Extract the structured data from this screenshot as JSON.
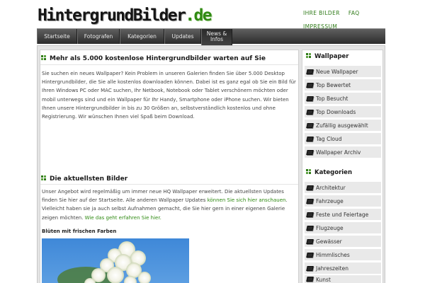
{
  "logo": {
    "part1": "HintergrundBilder",
    "part2": ".de"
  },
  "top_links": [
    "IHRE BILDER",
    "FAQ",
    "IMPRESSUM"
  ],
  "nav": [
    "Startseite",
    "Fotografen",
    "Kategorien",
    "Updates",
    "News &\nInfos"
  ],
  "intro": {
    "heading": "Mehr als 5.000 kostenlose Hintergrundbilder warten auf Sie",
    "text": "Sie suchen ein neues Wallpaper? Kein Problem in unseren Galerien finden Sie über 5.000 Desktop Hintergrundbilder, die Sie alle kostenlos downloaden können. Dabei ist es ganz egal ob Sie ein Bild für Ihren Windows PC oder MAC suchen, Ihr Netbook, Notebook oder Tablet verschönern möchten oder mobil unterwegs sind und ein Wallpaper für Ihr Handy, Smartphone oder iPhone suchen. Wir bieten Ihnen unsere Hintergrundbilder in bis zu 30 Größen an, selbstverständlich kostenlos und ohne Registrierung. Wir wünschen Ihnen viel Spaß beim Download."
  },
  "latest": {
    "heading": "Die aktuellsten Bilder",
    "text_1": "Unser Angebot wird regelmäßig um immer neue HQ Wallpaper erweitert. Die aktuellsten Updates finden Sie hier auf der Startseite. Alle anderen Wallpaper Updates ",
    "link_1": "können Sie sich hier anschauen",
    "text_2": ". Vielleicht haben sie ja auch selbst Aufnahmen gemacht, die Sie hier gern in einer eigenen Galerie zeigen möchten. ",
    "link_2": "Wie das geht erfahren Sie hier.",
    "subheading": "Blüten mit frischen Farben"
  },
  "sidebar": {
    "wallpaper_title": "Wallpaper",
    "wallpaper_items": [
      "Neue Wallpaper",
      "Top Bewertet",
      "Top Besucht",
      "Top Downloads",
      "Zufällig ausgewählt",
      "Tag Cloud",
      "Wallpaper Archiv"
    ],
    "kategorien_title": "Kategorien",
    "kategorien_items": [
      "Architektur",
      "Fahrzeuge",
      "Feste und Feiertage",
      "Flugzeuge",
      "Gewässer",
      "Himmlisches",
      "Jahreszeiten",
      "Kunst"
    ]
  },
  "colors": {
    "accent": "#2f8a12",
    "nav": "#3a3a3a"
  }
}
